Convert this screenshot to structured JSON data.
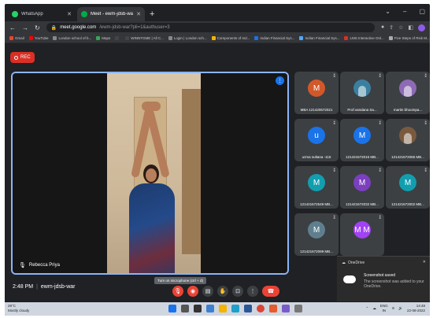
{
  "browser": {
    "tabs": [
      {
        "title": "WhatsApp",
        "color": "#25d366",
        "active": false
      },
      {
        "title": "Meet - ewm-jdsb-war",
        "color": "#00ac47",
        "active": true
      }
    ],
    "new_tab_glyph": "+",
    "url_host": "meet.google.com",
    "url_path": "/ewm-jdsb-war?pli=1&authuser=3",
    "bookmarks": [
      {
        "label": "Gmail",
        "color": "#ea4335"
      },
      {
        "label": "YouTube",
        "color": "#ff0000"
      },
      {
        "label": "London school of b...",
        "color": "#888888"
      },
      {
        "label": "Maps",
        "color": "#34a853"
      },
      {
        "label": "",
        "color": "#444444"
      },
      {
        "label": "WINNTGME | All C...",
        "color": "#444444"
      },
      {
        "label": "Login | London sch...",
        "color": "#888888"
      },
      {
        "label": "Components of Ind...",
        "color": "#f4b400"
      },
      {
        "label": "Indian Financial Sys...",
        "color": "#1a73e8"
      },
      {
        "label": "Indian Financial Sys...",
        "color": "#4fa8ff"
      },
      {
        "label": "LMS Interactive Onl...",
        "color": "#d93025"
      },
      {
        "label": "Five Steps of Risk M...",
        "color": "#aaaaaa"
      }
    ]
  },
  "meet": {
    "rec_label": "REC",
    "main_speaker": "Rebecca Priya",
    "tiles": [
      {
        "name": "MBA 121420672021",
        "initial": "M",
        "avatar_color": "#d2582a",
        "type": "letter"
      },
      {
        "name": "Prof.vandana Sa...",
        "initial": "",
        "avatar_color": "#3b7fa0",
        "type": "photo"
      },
      {
        "name": "martin bhoompa...",
        "initial": "",
        "avatar_color": "#8e6ab5",
        "type": "photo"
      },
      {
        "name": "uzma sultana -115",
        "initial": "u",
        "avatar_color": "#1a73e8",
        "type": "letter"
      },
      {
        "name": "121421672016 MB...",
        "initial": "M",
        "avatar_color": "#1a73e8",
        "type": "letter"
      },
      {
        "name": "121421672065 MB...",
        "initial": "",
        "avatar_color": "#7a5a3f",
        "type": "photo"
      },
      {
        "name": "121421672549 MB...",
        "initial": "M",
        "avatar_color": "#129eaf",
        "type": "letter"
      },
      {
        "name": "121421672032 MB...",
        "initial": "M",
        "avatar_color": "#7b3fbf",
        "type": "letter"
      },
      {
        "name": "121421672002 MB...",
        "initial": "M",
        "avatar_color": "#129eaf",
        "type": "letter"
      },
      {
        "name": "121421672099 MB...",
        "initial": "M",
        "avatar_color": "#5f7f8f",
        "type": "letter"
      },
      {
        "name": "",
        "initial": "M M",
        "avatar_color": "#a142f4",
        "type": "letter"
      }
    ],
    "time": "2:48 PM",
    "meeting_code": "ewm-jdsb-war",
    "tooltip": "Turn on microphone (ctrl + d)"
  },
  "toast": {
    "app": "OneDrive",
    "title": "Screenshot saved",
    "body": "The screenshot was added to your OneDrive."
  },
  "taskbar": {
    "weather_temp": "28°C",
    "weather_desc": "Mostly cloudy",
    "lang": "ENG",
    "region": "IN",
    "time": "14:48",
    "date": "22-08-2022"
  }
}
